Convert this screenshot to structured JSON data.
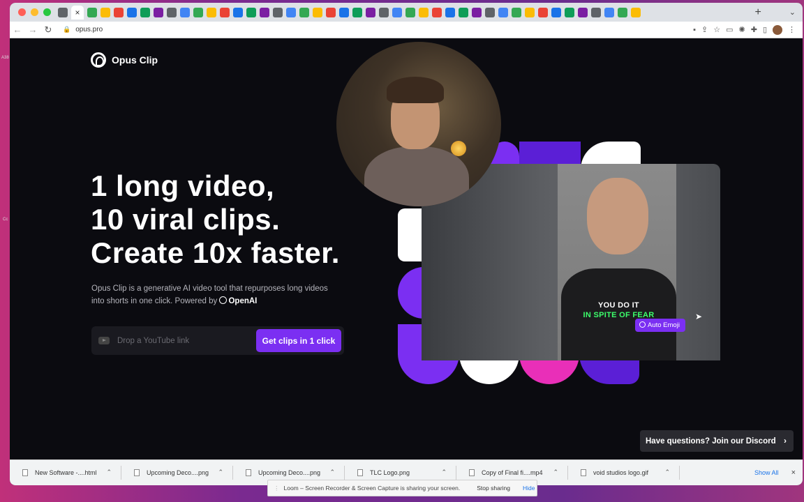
{
  "browser": {
    "url": "opus.pro",
    "tab_icons": [
      "chat-icon",
      "close-tab-icon",
      "doc-icon",
      "doc-icon",
      "photo-icon",
      "docs-icon",
      "doc-icon",
      "drive-icon",
      "sheets-icon",
      "drive-icon",
      "slides-icon",
      "doc-icon",
      "doc-icon",
      "doc-icon",
      "doc-icon",
      "doc-icon",
      "doc-icon",
      "app-icon",
      "back-icon",
      "globe-icon",
      "facebook-icon",
      "meta-icon",
      "globe-icon",
      "linkedin-icon",
      "app-icon",
      "globe-icon",
      "app-icon",
      "app-icon",
      "app-icon",
      "chrome-icon",
      "app-icon",
      "app-icon",
      "app-icon",
      "app-icon",
      "app-icon",
      "app-icon",
      "app-icon",
      "app-icon",
      "app-icon",
      "app-icon",
      "app-icon",
      "app-icon",
      "app-icon",
      "app-icon"
    ],
    "new_tab": "+",
    "tab_menu": "⌄"
  },
  "site": {
    "brand": "Opus Clip",
    "headline": [
      "1 long video,",
      "10 viral clips.",
      "Create 10x faster."
    ],
    "subtext": "Opus Clip is a generative AI video tool that repurposes long videos into shorts in one click. Powered by",
    "powered_by": "OpenAI",
    "input_placeholder": "Drop a YouTube link",
    "cta_label": "Get clips in 1 click",
    "video_caption_line1": "YOU DO IT",
    "video_caption_line2": "IN SPITE OF FEAR",
    "auto_emoji_label": "Auto Emoji",
    "discord_label": "Have questions? Join our Discord",
    "accent": "#7b2ff2",
    "caption_green": "#3cff6b",
    "shape_colors": [
      "#7b2ff2",
      "#ffffff",
      "#e92fb8",
      "#5b1fd6"
    ]
  },
  "downloads": {
    "items": [
      {
        "name": "New Software -....html"
      },
      {
        "name": "Upcoming Deco....png"
      },
      {
        "name": "Upcoming Deco....png"
      },
      {
        "name": "TLC Logo.png"
      },
      {
        "name": "Copy of Final fi....mp4"
      },
      {
        "name": "void studios logo.gif"
      }
    ],
    "show_all": "Show All",
    "close": "×"
  },
  "sharing_banner": {
    "message": "Loom – Screen Recorder & Screen Capture is sharing your screen.",
    "stop_label": "Stop sharing",
    "hide_label": "Hide"
  }
}
